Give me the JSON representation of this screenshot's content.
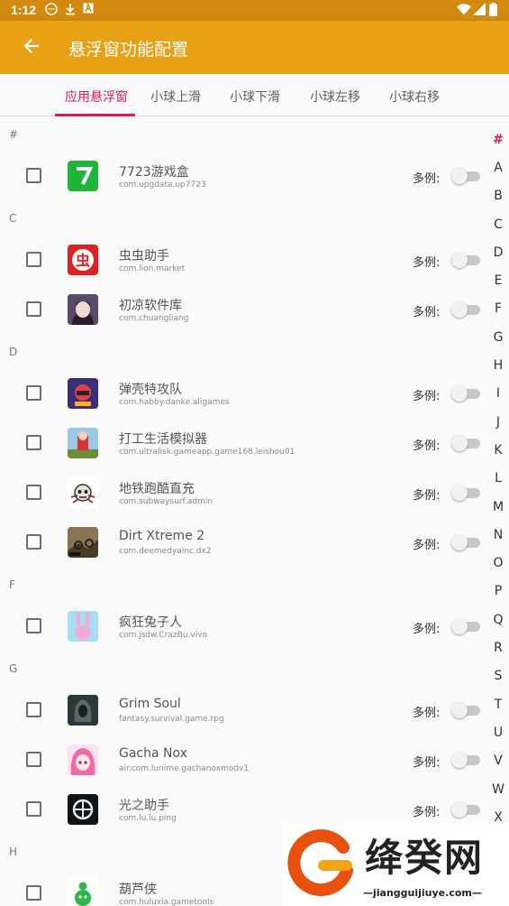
{
  "status_bar": {
    "time": "1:12",
    "icons": [
      "chat-icon",
      "download-icon",
      "a-icon",
      "wifi-icon",
      "signal-icon",
      "battery-icon"
    ]
  },
  "app_bar": {
    "title": "悬浮窗功能配置",
    "back_icon": "arrow-left-icon"
  },
  "tabs": [
    {
      "label": "应用悬浮窗",
      "active": true
    },
    {
      "label": "小球上滑",
      "active": false
    },
    {
      "label": "小球下滑",
      "active": false
    },
    {
      "label": "小球左移",
      "active": false
    },
    {
      "label": "小球右移",
      "active": false
    }
  ],
  "multi_label": "多例:",
  "sections": {
    "hash": "#",
    "c": "C",
    "d": "D",
    "f": "F",
    "g": "G",
    "h": "H"
  },
  "apps": [
    {
      "name": "7723游戏盒",
      "package": "com.upgdata.up7723",
      "checked": false,
      "multi": false
    },
    {
      "name": "虫虫助手",
      "package": "com.lion.market",
      "checked": false,
      "multi": false
    },
    {
      "name": "初凉软件库",
      "package": "com.chuangliang",
      "checked": false,
      "multi": false
    },
    {
      "name": "弹壳特攻队",
      "package": "com.habby.danke.aligames",
      "checked": false,
      "multi": false
    },
    {
      "name": "打工生活模拟器",
      "package": "com.ultralisk.gameapp.game168.leishou01",
      "checked": false,
      "multi": false
    },
    {
      "name": "地铁跑酷直充",
      "package": "com.subwaysurf.admin",
      "checked": false,
      "multi": false
    },
    {
      "name": "Dirt Xtreme 2",
      "package": "com.deemedyainc.dx2",
      "checked": false,
      "multi": false
    },
    {
      "name": "疯狂兔子人",
      "package": "com.jsdw.CrazBu.vivo",
      "checked": false,
      "multi": false
    },
    {
      "name": "Grim Soul",
      "package": "fantasy.survival.game.rpg",
      "checked": false,
      "multi": false
    },
    {
      "name": "Gacha Nox",
      "package": "air.com.lunime.gachanoxmodv1",
      "checked": false,
      "multi": false
    },
    {
      "name": "光之助手",
      "package": "com.lu.lu.ping",
      "checked": false,
      "multi": false
    },
    {
      "name": "葫芦侠",
      "package": "com.huluxia.gametools",
      "checked": false,
      "multi": false
    }
  ],
  "alpha_index": [
    "#",
    "A",
    "B",
    "C",
    "D",
    "E",
    "F",
    "G",
    "H",
    "I",
    "J",
    "K",
    "L",
    "M",
    "N",
    "O",
    "P",
    "Q",
    "R",
    "S",
    "T",
    "U",
    "V",
    "W",
    "X"
  ],
  "watermark": {
    "name": "绛癸网",
    "domain": "—jiangguijiuye.com—"
  },
  "colors": {
    "app_bar": "#e8a015",
    "status_bar": "#d18a0f",
    "accent": "#d81b60"
  }
}
